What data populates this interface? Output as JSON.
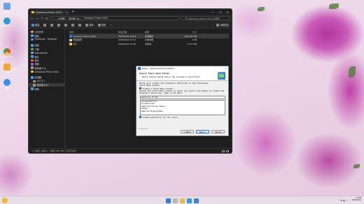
{
  "desktop": {
    "icons": [
      {
        "label": "回收站",
        "color": "#6aa4e6"
      },
      {
        "label": "Microsoft Edge",
        "color": "#2e9bd6"
      },
      {
        "label": "Google Chrome",
        "color": "#e8b238"
      },
      {
        "label": "Vortex",
        "color": "#f6a530"
      },
      {
        "label": "网络",
        "color": "#3b8ee8"
      }
    ]
  },
  "explorer": {
    "tab_title": "Geneious Prime 2024",
    "nav": {
      "back": "←",
      "forward": "→",
      "up": "↑",
      "refresh": "⟳",
      "address": [
        "此电脑",
        "新加坡 (D:)",
        "Geneious Prime 2024"
      ],
      "search_placeholder": "在 Geneious Prime 2024 中搜索"
    },
    "toolbar": {
      "new": "新建",
      "sort": "排序",
      "view": "查看",
      "more": "···",
      "details": "详细信息"
    },
    "sidebar": [
      {
        "label": "主文件夹",
        "color": "#e8a64a",
        "indent": false
      },
      {
        "label": "图库",
        "color": "#4aa0e8",
        "indent": false
      },
      {
        "label": "OneDrive - Personal",
        "color": "#3c8ce0",
        "indent": false
      },
      {
        "gap": true
      },
      {
        "label": "桌面",
        "color": "#4aa0e8",
        "indent": false
      },
      {
        "label": "下载",
        "color": "#3fb46a",
        "indent": false
      },
      {
        "label": "Documents",
        "color": "#8aa6c8",
        "indent": false
      },
      {
        "label": "图片",
        "color": "#4aa0e8",
        "indent": false
      },
      {
        "label": "音乐",
        "color": "#e2643b",
        "indent": false
      },
      {
        "label": "视频",
        "color": "#9b59d0",
        "indent": false
      },
      {
        "label": "新加坡 (D:)",
        "color": "#9a9a9a",
        "indent": false
      },
      {
        "label": "Geneious Prime 2024",
        "color": "#e8b84a",
        "indent": false
      },
      {
        "gap": true
      },
      {
        "label": "此电脑",
        "color": "#4aa0e8",
        "indent": false
      },
      {
        "label": "OS (C:)",
        "color": "#9a9a9a",
        "indent": true
      },
      {
        "label": "新加坡 (D:)",
        "color": "#9a9a9a",
        "indent": true,
        "active": true
      },
      {
        "label": "网络",
        "color": "#4aa0e8",
        "indent": false
      }
    ],
    "columns": {
      "name": "名称",
      "date": "修改日期",
      "type": "类型",
      "size": "大小"
    },
    "files": [
      {
        "name": "Geneious Prime 2024",
        "date": "2025/3/24 13:23",
        "type": "应用程序",
        "size": "595,263 KB",
        "color": "#2f6fcf"
      },
      {
        "name": "安装说明",
        "date": "2025/3/24 17:13",
        "type": "文本文档",
        "size": "1 KB",
        "color": "#dcdcdc"
      },
      {
        "name": "补丁",
        "date": "2025/3/24 13:23",
        "type": "文件夹",
        "size": "3,277 KB",
        "color": "#e8b84a"
      }
    ],
    "status": "3 个项目  |  选中 1 个项目  585 MB  |  已打开文件"
  },
  "dialog": {
    "title": "Setup - Geneious Prime 2024.0",
    "minimize": "—",
    "close": "✕",
    "heading": "Select Start Menu Folder",
    "subheading": "Where should Setup place the program's shortcuts?",
    "line1": "Setup will create the program's shortcuts in the following",
    "line1b": "Start Menu folder.",
    "create_folder": "Create a Start Menu folder",
    "line2": "Select the Start Menu folder in which you would like Setup to create the",
    "line2b": "program's shortcuts, then click Next.",
    "folder_value": "Geneious Prime",
    "folders": [
      "Accessibility",
      "Accessories",
      "Administrative Tools",
      "Adobe",
      "Applied Biosystems"
    ],
    "create_all": "Create shortcuts for all users",
    "brand": "Geneious",
    "back": "< Back",
    "next": "Next >",
    "cancel": "Cancel"
  },
  "taskbar": {
    "apps": [
      {
        "name": "windows-start",
        "color": "#2f7de0"
      },
      {
        "name": "search",
        "color": "#b8b8b8"
      },
      {
        "name": "file-explorer",
        "color": "#e8b84a"
      },
      {
        "name": "edge",
        "color": "#2e9bd6"
      },
      {
        "name": "setup",
        "color": "#4a7fd0"
      }
    ],
    "time": "14:08",
    "date": "2025/3/24",
    "tray": "^ 中 ◐ ♪"
  }
}
